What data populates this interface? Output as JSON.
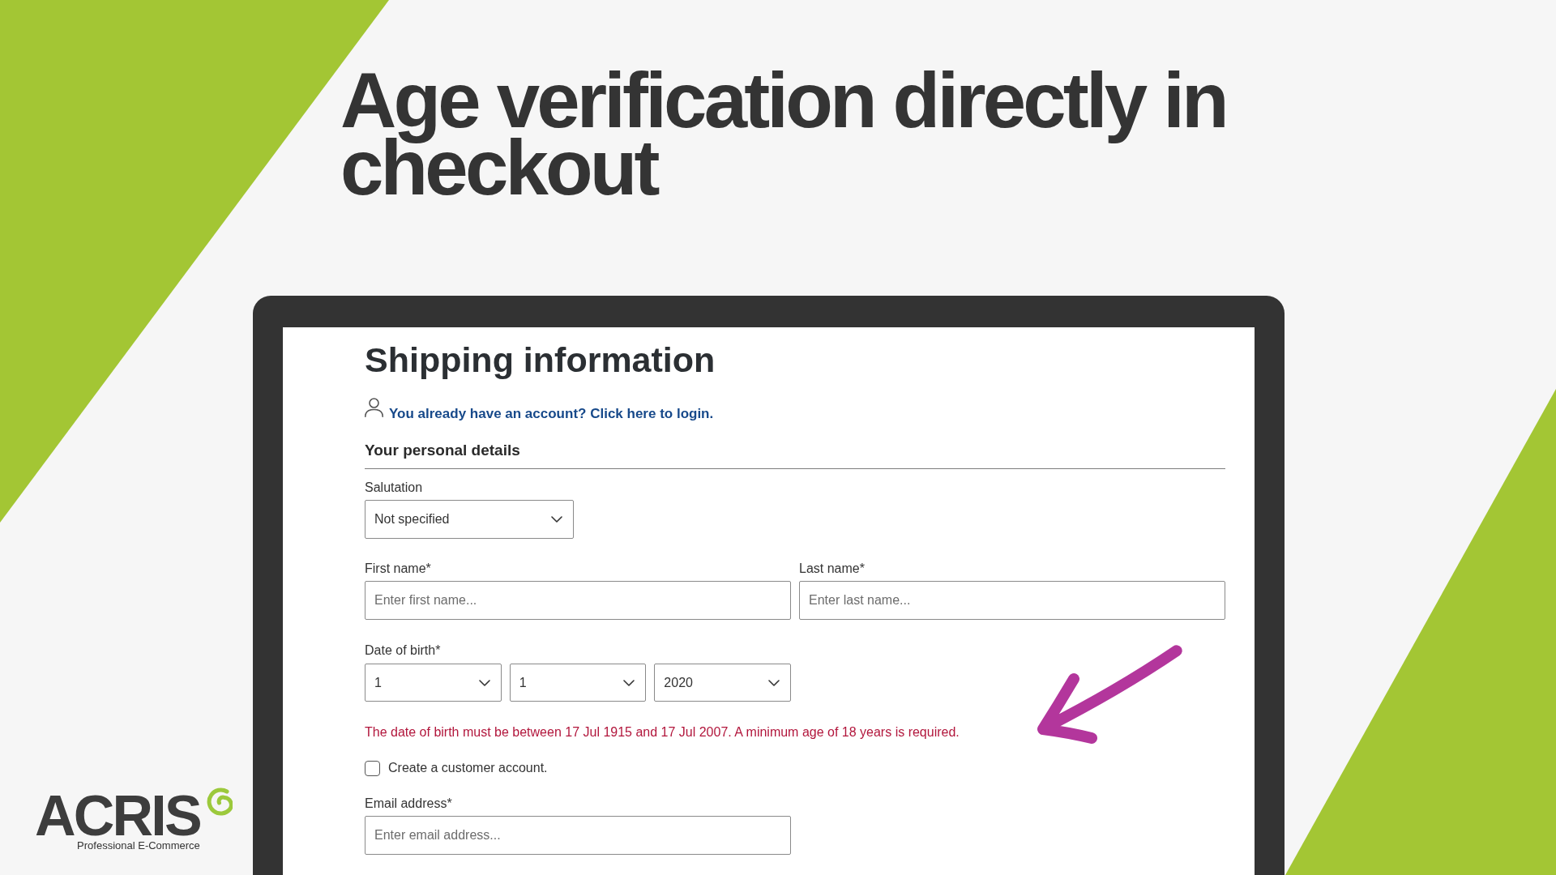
{
  "headline": "Age verification directly in checkout",
  "screen": {
    "heading": "Shipping information",
    "login_link": "You already have an account? Click here to login.",
    "section_title": "Your personal details",
    "salutation": {
      "label": "Salutation",
      "value": "Not specified"
    },
    "name_fields": [
      {
        "label": "First name*",
        "placeholder": "Enter first name..."
      },
      {
        "label": "Last name*",
        "placeholder": "Enter last name..."
      }
    ],
    "date_of_birth": {
      "label": "Date of birth*",
      "selects": [
        {
          "value": "1"
        },
        {
          "value": "1"
        },
        {
          "value": "2020"
        }
      ]
    },
    "error_message": "The date of birth must be between 17 Jul 1915 and 17 Jul 2007. A minimum age of 18 years is required.",
    "create_account": {
      "label": "Create a customer account.",
      "checked": false
    },
    "email": {
      "label": "Email address*",
      "placeholder": "Enter email address..."
    }
  },
  "logo": {
    "wordmark": "ACRIS",
    "tagline": "Professional E-Commerce"
  }
}
